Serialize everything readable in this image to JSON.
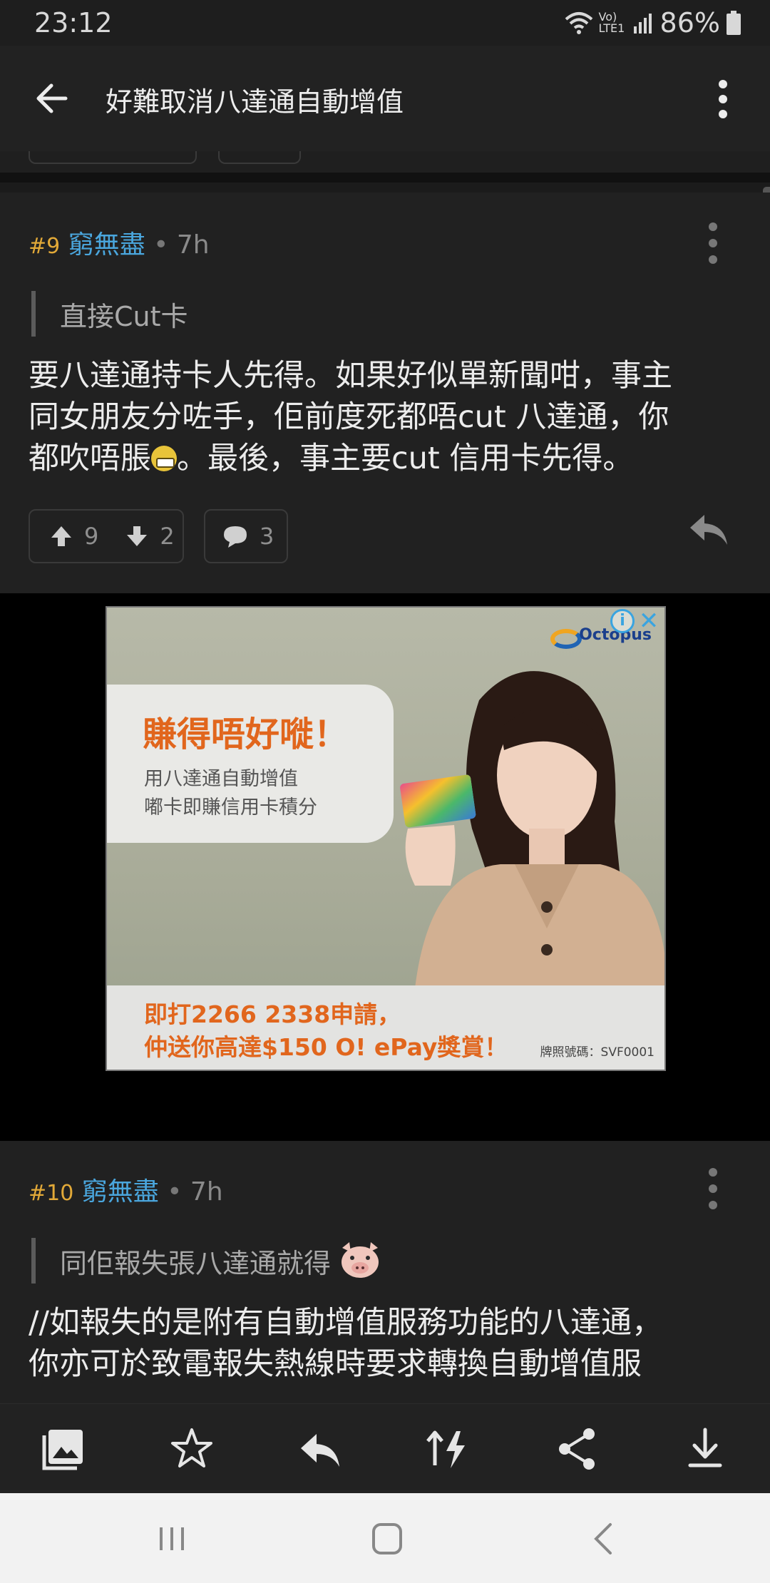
{
  "status_bar": {
    "time": "23:12",
    "network": "Vo) LTE1",
    "battery": "86%"
  },
  "app_bar": {
    "title": "好難取消八達通自動增值",
    "back_icon": "arrow-left-icon",
    "more_icon": "more-vert-icon"
  },
  "posts": [
    {
      "number": "#9",
      "username": "窮無盡",
      "separator": "•",
      "time": "7h",
      "quote": "直接Cut卡",
      "body_lines": [
        "要八達通持卡人先得。如果好似單新聞咁，事主",
        "同女朋友分咗手，佢前度死都唔cut 八達通，你",
        "都吹唔脹",
        "。最後，事主要cut 信用卡先得。"
      ],
      "upvotes": "9",
      "downvotes": "2",
      "comments": "3"
    },
    {
      "number": "#10",
      "username": "窮無盡",
      "separator": "•",
      "time": "7h",
      "quote": "同佢報失張八達通就得",
      "body_lines": [
        "//如報失的是附有自動增值服務功能的八達通，",
        "你亦可於致電報失熱線時要求轉換自動增值服"
      ]
    }
  ],
  "ad": {
    "logo_text": "Octopus",
    "info": "i",
    "close": "✕",
    "headline": "賺得唔好嘥！",
    "sub1": "用八達通自動增值",
    "sub2": "嘟卡即賺信用卡積分",
    "cta1": "即打2266 2338申請，",
    "cta2": "仲送你高達$150 O! ePay獎賞！",
    "license": "牌照號碼：SVF0001"
  },
  "toolbar": {
    "items": [
      "image-icon",
      "star-icon",
      "reply-icon",
      "sort-icon",
      "share-icon",
      "download-icon"
    ]
  },
  "navbar": {
    "items": [
      "recent-apps-icon",
      "home-icon",
      "back-icon"
    ]
  },
  "colors": {
    "accent_user": "#4aa6dd",
    "post_number": "#e2a938",
    "ad_orange": "#e1661d"
  }
}
